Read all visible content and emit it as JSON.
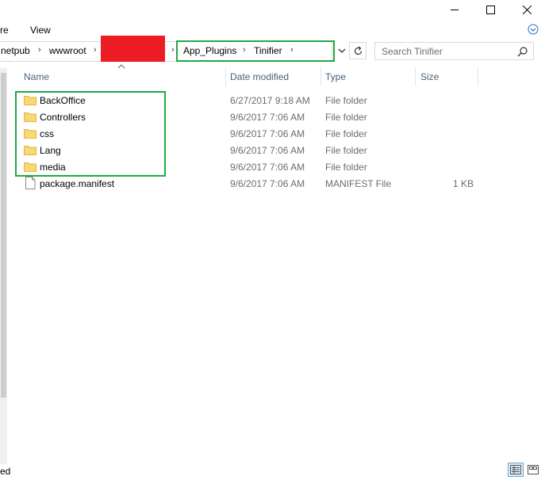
{
  "ribbon": {
    "tabs": [
      {
        "label": "re"
      },
      {
        "label": "View"
      }
    ]
  },
  "address": {
    "crumbs": [
      "netpub",
      "wwwroot",
      "App_Plugins",
      "Tinifier"
    ]
  },
  "search": {
    "placeholder": "Search Tinifier"
  },
  "columns": {
    "name": "Name",
    "date": "Date modified",
    "type": "Type",
    "size": "Size"
  },
  "files": [
    {
      "name": "BackOffice",
      "date": "6/27/2017 9:18 AM",
      "type": "File folder",
      "size": "",
      "icon": "folder-icon"
    },
    {
      "name": "Controllers",
      "date": "9/6/2017 7:06 AM",
      "type": "File folder",
      "size": "",
      "icon": "folder-icon"
    },
    {
      "name": "css",
      "date": "9/6/2017 7:06 AM",
      "type": "File folder",
      "size": "",
      "icon": "folder-icon"
    },
    {
      "name": "Lang",
      "date": "9/6/2017 7:06 AM",
      "type": "File folder",
      "size": "",
      "icon": "folder-icon"
    },
    {
      "name": "media",
      "date": "9/6/2017 7:06 AM",
      "type": "File folder",
      "size": "",
      "icon": "folder-icon"
    },
    {
      "name": "package.manifest",
      "date": "9/6/2017 7:06 AM",
      "type": "MANIFEST File",
      "size": "1 KB",
      "icon": "file-icon"
    }
  ],
  "status": {
    "text": "ed"
  },
  "colors": {
    "highlight_box": "#22a845",
    "redaction": "#ed1c24",
    "folder": "#f8d775",
    "header_text": "#4c607a"
  }
}
